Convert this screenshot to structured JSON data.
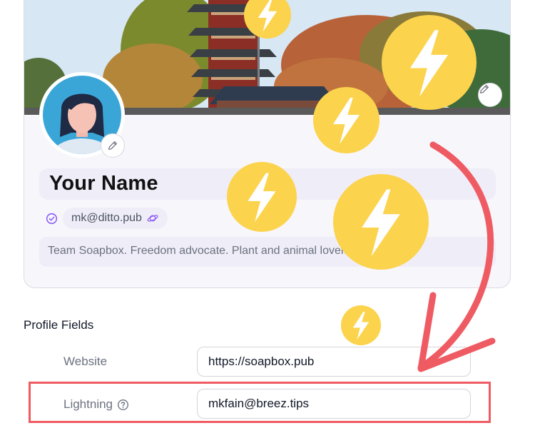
{
  "profile": {
    "display_name": "Your Name",
    "nip05": "mk@ditto.pub",
    "bio": "Team Soapbox. Freedom advocate. Plant and animal lover. Reader and"
  },
  "fields_section": {
    "title": "Profile Fields",
    "website": {
      "label": "Website",
      "value": "https://soapbox.pub"
    },
    "lightning": {
      "label": "Lightning",
      "value": "mkfain@breez.tips"
    }
  },
  "icons": {
    "banner_edit": "pencil-icon",
    "avatar_edit": "pencil-icon",
    "verified": "check-circle-icon",
    "nip05_badge": "planet-icon",
    "help": "question-circle-icon",
    "zap": "lightning-bolt-icon"
  },
  "colors": {
    "accent": "#8b5cf6",
    "zap_yellow": "#fcd34d",
    "annotation_red": "#ef5b63",
    "input_bg": "#efedf7"
  }
}
